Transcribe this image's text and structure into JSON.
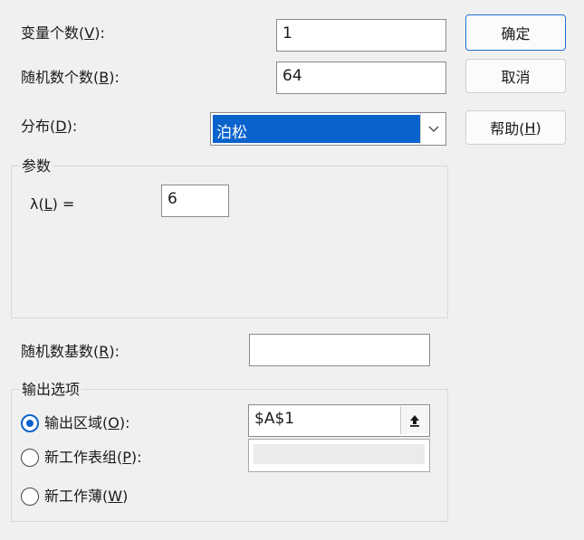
{
  "dialog": {
    "fields": {
      "num_variables": {
        "label_pre": "变量个数(",
        "hotkey": "V",
        "label_post": "):",
        "value": "1"
      },
      "num_random": {
        "label_pre": "随机数个数(",
        "hotkey": "B",
        "label_post": "):",
        "value": "64"
      },
      "distribution": {
        "label_pre": "分布(",
        "hotkey": "D",
        "label_post": "):",
        "value": "泊松"
      }
    },
    "buttons": {
      "ok": "确定",
      "cancel": "取消",
      "help_pre": "帮助(",
      "help_hotkey": "H",
      "help_post": ")"
    },
    "parameters": {
      "title": "参数",
      "lambda_pre": "λ(",
      "lambda_hotkey": "L",
      "lambda_post": ")  =",
      "lambda_value": "6"
    },
    "seed": {
      "label_pre": "随机数基数(",
      "hotkey": "R",
      "label_post": "):",
      "value": ""
    },
    "output": {
      "title": "输出选项",
      "options": [
        {
          "label_pre": "输出区域(",
          "hotkey": "O",
          "label_post": "):",
          "selected": true,
          "value": "$A$1"
        },
        {
          "label_pre": "新工作表组(",
          "hotkey": "P",
          "label_post": "):",
          "selected": false,
          "value": ""
        },
        {
          "label_pre": "新工作薄(",
          "hotkey": "W",
          "label_post": ")",
          "selected": false
        }
      ]
    },
    "icons": {
      "dropdown": "chevron-down-icon",
      "range_select": "collapse-dialog-icon"
    },
    "colors": {
      "accent": "#0a63cc",
      "background": "#f0f0f0"
    }
  }
}
